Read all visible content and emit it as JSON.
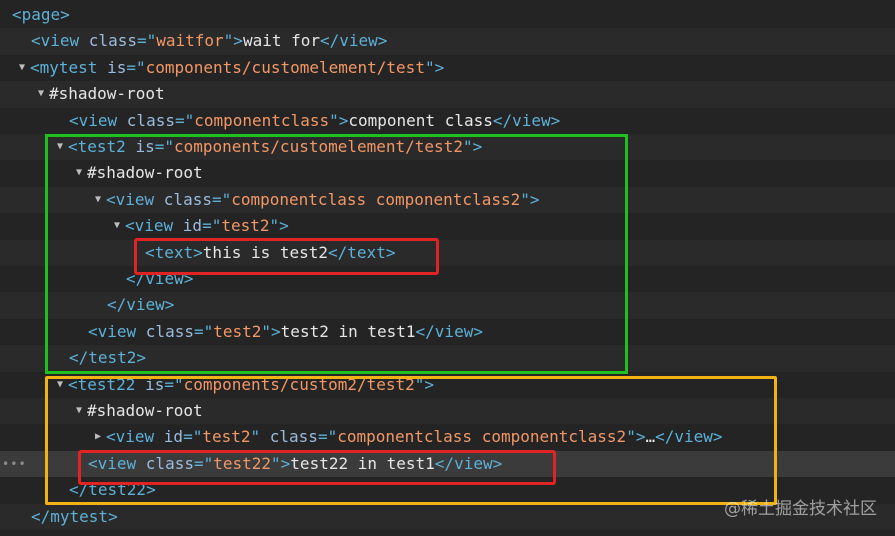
{
  "lines": [
    {
      "indent": 0,
      "toggle": "",
      "segments": [
        [
          "tag",
          "<page>"
        ]
      ]
    },
    {
      "indent": 1,
      "toggle": "",
      "segments": [
        [
          "tag",
          "<view "
        ],
        [
          "attr",
          "class"
        ],
        [
          "tag",
          "=\""
        ],
        [
          "val",
          "waitfor"
        ],
        [
          "tag",
          "\">"
        ],
        [
          "txt",
          "wait for"
        ],
        [
          "tag",
          "</view>"
        ]
      ]
    },
    {
      "indent": 1,
      "toggle": "open",
      "segments": [
        [
          "tag",
          "<mytest "
        ],
        [
          "attr",
          "is"
        ],
        [
          "tag",
          "=\""
        ],
        [
          "val",
          "components/customelement/test"
        ],
        [
          "tag",
          "\">"
        ]
      ]
    },
    {
      "indent": 2,
      "toggle": "open",
      "segments": [
        [
          "txt",
          "#shadow-root"
        ]
      ]
    },
    {
      "indent": 3,
      "toggle": "",
      "segments": [
        [
          "tag",
          "<view "
        ],
        [
          "attr",
          "class"
        ],
        [
          "tag",
          "=\""
        ],
        [
          "val",
          "componentclass"
        ],
        [
          "tag",
          "\">"
        ],
        [
          "txt",
          "component class"
        ],
        [
          "tag",
          "</view>"
        ]
      ]
    },
    {
      "indent": 3,
      "toggle": "open",
      "segments": [
        [
          "tag",
          "<test2 "
        ],
        [
          "attr",
          "is"
        ],
        [
          "tag",
          "=\""
        ],
        [
          "val",
          "components/customelement/test2"
        ],
        [
          "tag",
          "\">"
        ]
      ]
    },
    {
      "indent": 4,
      "toggle": "open",
      "segments": [
        [
          "txt",
          "#shadow-root"
        ]
      ]
    },
    {
      "indent": 5,
      "toggle": "open",
      "segments": [
        [
          "tag",
          "<view "
        ],
        [
          "attr",
          "class"
        ],
        [
          "tag",
          "=\""
        ],
        [
          "val",
          "componentclass componentclass2"
        ],
        [
          "tag",
          "\">"
        ]
      ]
    },
    {
      "indent": 6,
      "toggle": "open",
      "segments": [
        [
          "tag",
          "<view "
        ],
        [
          "attr",
          "id"
        ],
        [
          "tag",
          "=\""
        ],
        [
          "val",
          "test2"
        ],
        [
          "tag",
          "\">"
        ]
      ]
    },
    {
      "indent": 7,
      "toggle": "",
      "segments": [
        [
          "tag",
          "<text>"
        ],
        [
          "txt",
          "this is test2"
        ],
        [
          "tag",
          "</text>"
        ]
      ]
    },
    {
      "indent": 6,
      "toggle": "",
      "segments": [
        [
          "tag",
          "</view>"
        ]
      ]
    },
    {
      "indent": 5,
      "toggle": "",
      "segments": [
        [
          "tag",
          "</view>"
        ]
      ]
    },
    {
      "indent": 4,
      "toggle": "",
      "segments": [
        [
          "tag",
          "<view "
        ],
        [
          "attr",
          "class"
        ],
        [
          "tag",
          "=\""
        ],
        [
          "val",
          "test2"
        ],
        [
          "tag",
          "\">"
        ],
        [
          "txt",
          "test2 in test1"
        ],
        [
          "tag",
          "</view>"
        ]
      ]
    },
    {
      "indent": 3,
      "toggle": "",
      "segments": [
        [
          "tag",
          "</test2>"
        ]
      ]
    },
    {
      "indent": 3,
      "toggle": "open",
      "segments": [
        [
          "tag",
          "<test22 "
        ],
        [
          "attr",
          "is"
        ],
        [
          "tag",
          "=\""
        ],
        [
          "val",
          "components/custom2/test2"
        ],
        [
          "tag",
          "\">"
        ]
      ]
    },
    {
      "indent": 4,
      "toggle": "open",
      "segments": [
        [
          "txt",
          "#shadow-root"
        ]
      ]
    },
    {
      "indent": 5,
      "toggle": "closed",
      "segments": [
        [
          "tag",
          "<view "
        ],
        [
          "attr",
          "id"
        ],
        [
          "tag",
          "=\""
        ],
        [
          "val",
          "test2"
        ],
        [
          "tag",
          "\" "
        ],
        [
          "attr",
          "class"
        ],
        [
          "tag",
          "=\""
        ],
        [
          "val",
          "componentclass componentclass2"
        ],
        [
          "tag",
          "\">"
        ],
        [
          "txt",
          "…"
        ],
        [
          "tag",
          "</view>"
        ]
      ]
    },
    {
      "indent": 4,
      "toggle": "",
      "segments": [
        [
          "tag",
          "<view "
        ],
        [
          "attr",
          "class"
        ],
        [
          "tag",
          "=\""
        ],
        [
          "val",
          "test22"
        ],
        [
          "tag",
          "\">"
        ],
        [
          "txt",
          "test22 in test1"
        ],
        [
          "tag",
          "</view>"
        ]
      ]
    },
    {
      "indent": 3,
      "toggle": "",
      "segments": [
        [
          "tag",
          "</test22>"
        ]
      ]
    },
    {
      "indent": 1,
      "toggle": "",
      "segments": [
        [
          "tag",
          "</mytest>"
        ]
      ]
    }
  ],
  "selected_line": 17,
  "selected_hint": "•••",
  "icons": {
    "expanded": "triangle-down-icon",
    "collapsed": "triangle-right-icon"
  },
  "colors": {
    "tag": "#5db0d7",
    "attribute": "#9bbbdc",
    "value": "#f29766",
    "text": "#e6e6e6",
    "green_box": "#1fbf1f",
    "yellow_box": "#f2b215",
    "red_box": "#e02424"
  },
  "watermark": "@稀土掘金技术社区"
}
